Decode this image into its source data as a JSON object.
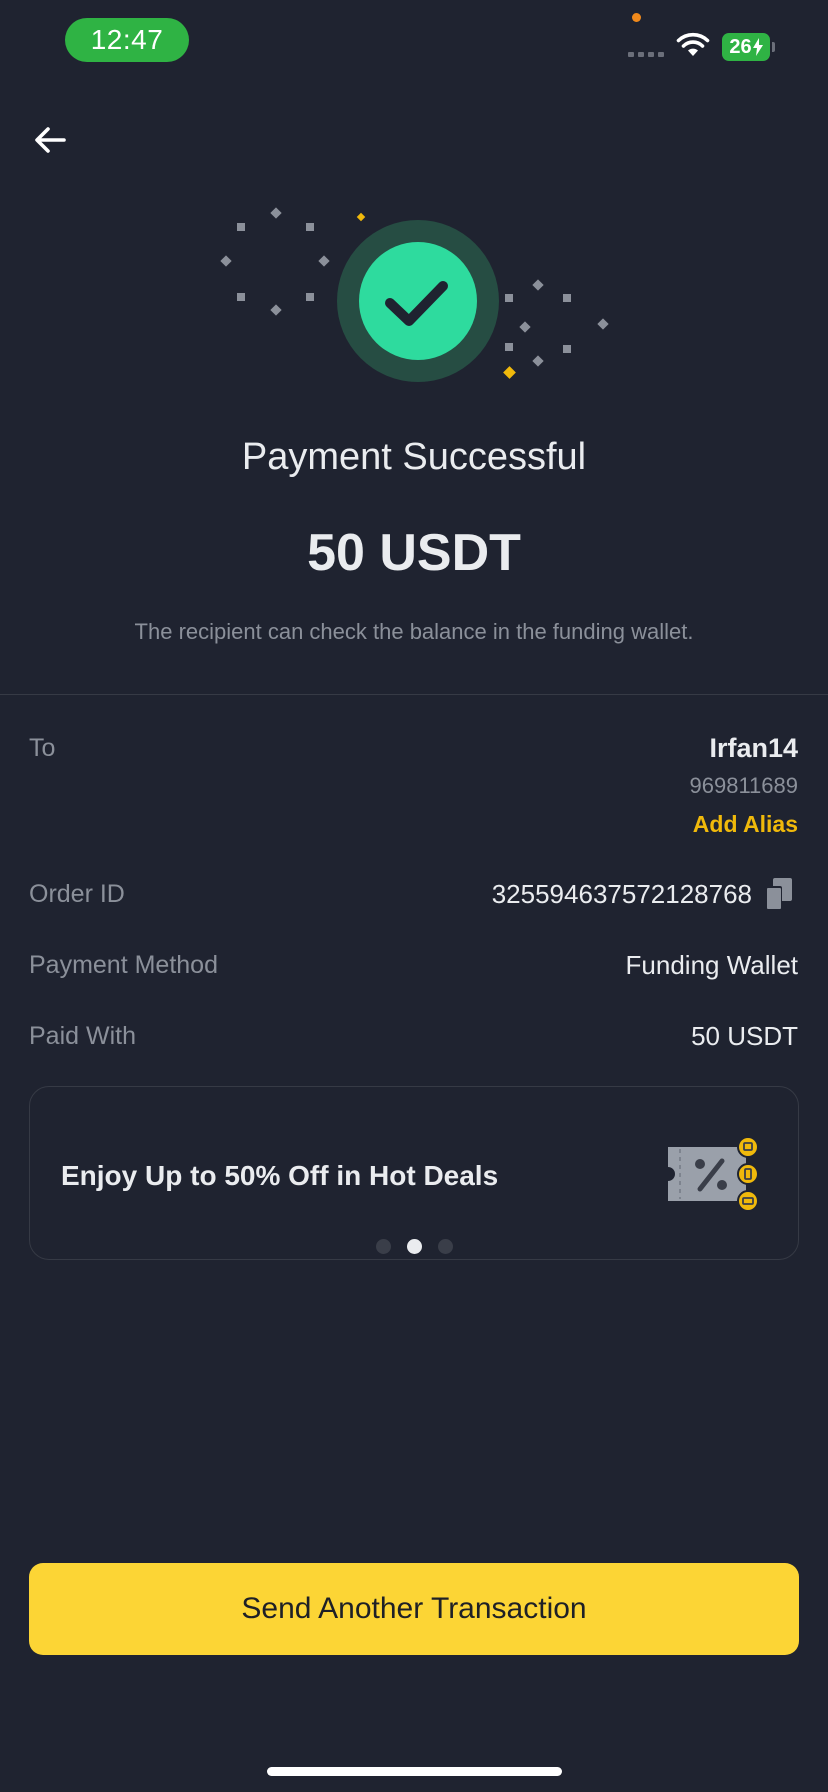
{
  "status_bar": {
    "time": "12:47",
    "battery": "26"
  },
  "header": {
    "back_icon": "arrow-left-icon"
  },
  "result": {
    "title": "Payment Successful",
    "amount": "50 USDT",
    "subtitle": "The recipient can check the balance in the funding wallet.",
    "icon": "check-circle-icon",
    "accent_color": "#2edb9e"
  },
  "details": {
    "to": {
      "label": "To",
      "name": "Irfan14",
      "id": "969811689",
      "add_alias": "Add Alias"
    },
    "order_id": {
      "label": "Order ID",
      "value": "325594637572128768",
      "icon": "copy-icon"
    },
    "payment_method": {
      "label": "Payment Method",
      "value": "Funding Wallet"
    },
    "paid_with": {
      "label": "Paid With",
      "value": "50 USDT"
    }
  },
  "banner": {
    "text": "Enjoy Up to 50% Off in Hot Deals",
    "icon": "discount-ticket-icon",
    "pages": 3,
    "active_page": 2
  },
  "actions": {
    "primary": "Send Another Transaction"
  },
  "colors": {
    "background": "#1f2330",
    "brand_yellow": "#fcd535",
    "link_yellow": "#f0b90b",
    "success_green": "#2edb9e"
  }
}
